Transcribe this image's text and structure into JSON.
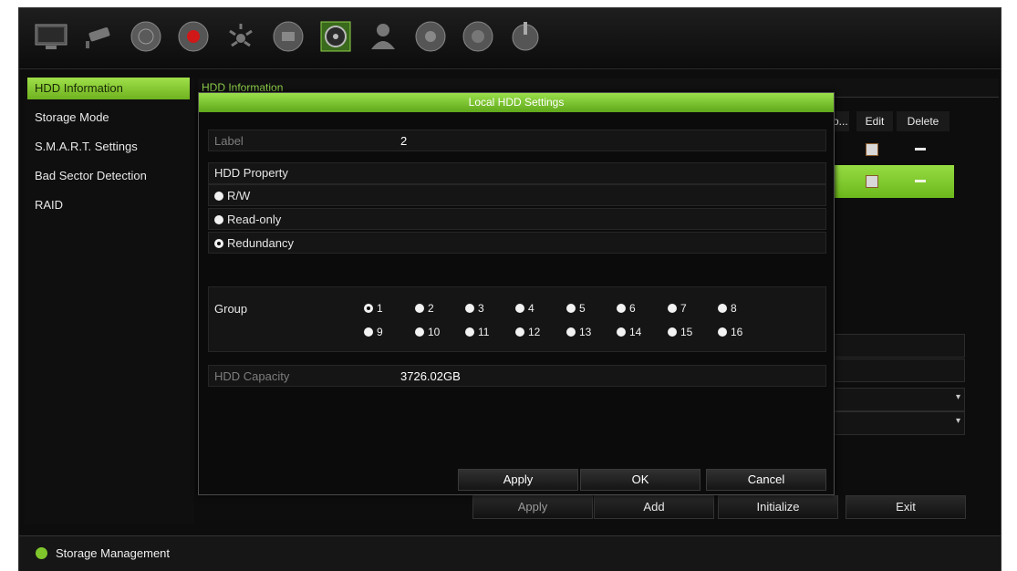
{
  "toolbar": {
    "icons": [
      "monitor-icon",
      "camera-icon",
      "network-icon",
      "record-icon",
      "alarm-icon",
      "schedule-icon",
      "storage-icon",
      "user-icon",
      "system-icon",
      "help-icon",
      "power-icon"
    ]
  },
  "sidebar": {
    "items": [
      {
        "label": "HDD Information",
        "active": true
      },
      {
        "label": "Storage Mode"
      },
      {
        "label": "S.M.A.R.T. Settings"
      },
      {
        "label": "Bad Sector Detection"
      },
      {
        "label": "RAID"
      }
    ]
  },
  "panel": {
    "title": "HDD Information",
    "columns_visible": [
      "o...",
      "Edit",
      "Delete"
    ],
    "buttons": {
      "apply": "Apply",
      "add": "Add",
      "initialize": "Initialize",
      "exit": "Exit"
    }
  },
  "dialog": {
    "title": "Local HDD Settings",
    "label_caption": "Label",
    "label_value": "2",
    "property_caption": "HDD Property",
    "property_options": [
      "R/W",
      "Read-only",
      "Redundancy"
    ],
    "property_selected": "Redundancy",
    "group_caption": "Group",
    "groups": [
      "1",
      "2",
      "3",
      "4",
      "5",
      "6",
      "7",
      "8",
      "9",
      "10",
      "11",
      "12",
      "13",
      "14",
      "15",
      "16"
    ],
    "group_selected": "1",
    "capacity_caption": "HDD Capacity",
    "capacity_value": "3726.02GB",
    "buttons": {
      "apply": "Apply",
      "ok": "OK",
      "cancel": "Cancel"
    }
  },
  "status": {
    "label": "Storage Management"
  },
  "colors": {
    "accent": "#7fc72b",
    "background": "#0d0d0d"
  }
}
